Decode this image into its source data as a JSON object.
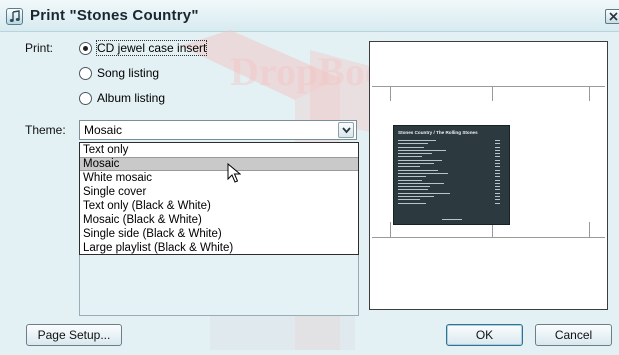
{
  "window": {
    "title": "Print \"Stones Country\"",
    "icon": "music-note-icon",
    "close_icon": "close-icon"
  },
  "print": {
    "label": "Print:",
    "options": [
      {
        "label": "CD jewel case insert",
        "checked": true
      },
      {
        "label": "Song listing",
        "checked": false
      },
      {
        "label": "Album listing",
        "checked": false
      }
    ]
  },
  "theme": {
    "label": "Theme:",
    "selected": "Mosaic",
    "options": [
      "Text only",
      "Mosaic",
      "White mosaic",
      "Single cover",
      "Text only (Black & White)",
      "Mosaic (Black & White)",
      "Single side (Black & White)",
      "Large playlist (Black & White)"
    ],
    "hovered_index": 1
  },
  "preview": {
    "insert_title": "Stones Country / The Rolling Stones",
    "track_count": 20
  },
  "buttons": {
    "page_setup": "Page Setup...",
    "ok": "OK",
    "cancel": "Cancel"
  },
  "watermark": {
    "text": "DropBooks"
  },
  "colors": {
    "background": "#e3f1f4",
    "title_bar": "#d7ebf0",
    "hover": "#c9c9c9",
    "insert_background": "#2c3a40",
    "watermark": "#f2c6c6"
  }
}
